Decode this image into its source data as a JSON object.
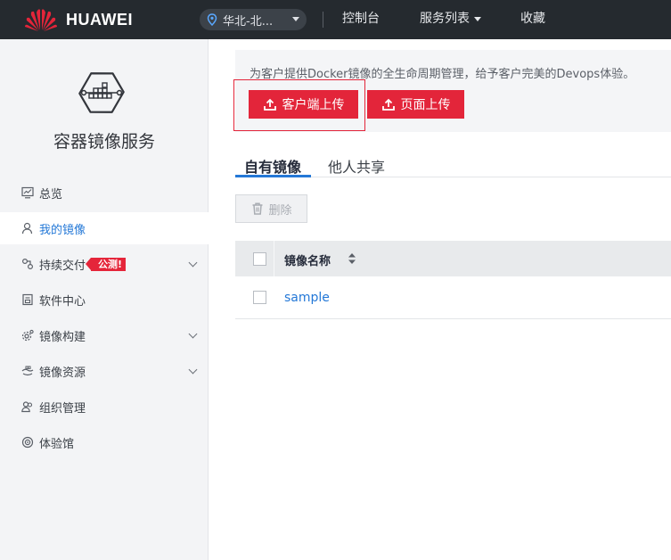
{
  "header": {
    "brand": "HUAWEI",
    "region": "华北-北...",
    "nav": [
      "控制台",
      "服务列表",
      "收藏"
    ]
  },
  "sidebar": {
    "service_title": "容器镜像服务",
    "items": [
      {
        "label": "总览",
        "icon": "dashboard-icon"
      },
      {
        "label": "我的镜像",
        "icon": "user-icon",
        "active": true
      },
      {
        "label": "持续交付",
        "icon": "delivery-icon",
        "badge": "公测!",
        "expandable": true
      },
      {
        "label": "软件中心",
        "icon": "software-icon"
      },
      {
        "label": "镜像构建",
        "icon": "build-gear-icon",
        "expandable": true
      },
      {
        "label": "镜像资源",
        "icon": "resource-icon",
        "expandable": true
      },
      {
        "label": "组织管理",
        "icon": "organization-icon"
      },
      {
        "label": "体验馆",
        "icon": "experience-icon"
      }
    ]
  },
  "main": {
    "banner_desc": "为客户提供Docker镜像的全生命周期管理，给予客户完美的Devops体验。",
    "client_upload_label": "客户端上传",
    "page_upload_label": "页面上传",
    "tabs": [
      "自有镜像",
      "他人共享"
    ],
    "delete_label": "删除",
    "table": {
      "columns": [
        "镜像名称"
      ],
      "rows": [
        {
          "name": "sample"
        }
      ]
    }
  },
  "colors": {
    "topbar": "#252a2f",
    "accent_red": "#e3253a",
    "link_blue": "#2478d7"
  }
}
